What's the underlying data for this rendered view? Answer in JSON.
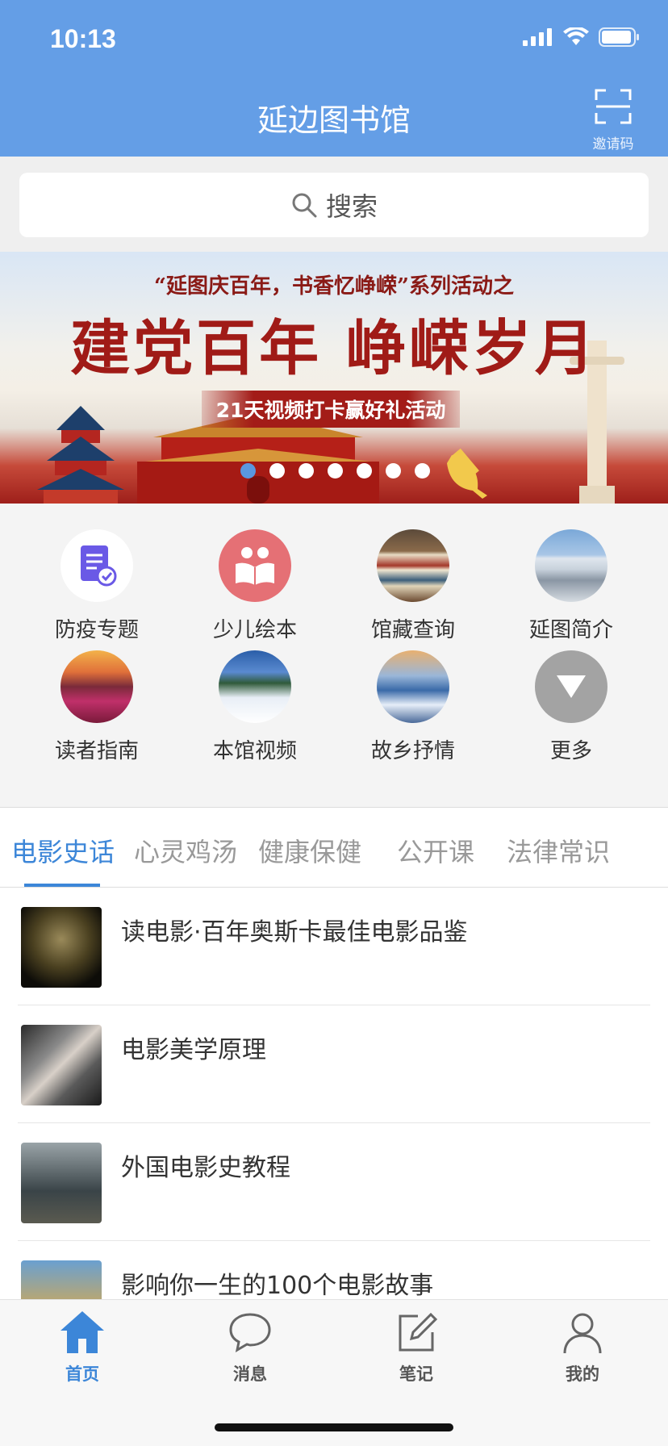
{
  "status_bar": {
    "time": "10:13"
  },
  "header": {
    "title": "延边图书馆",
    "invite_label": "邀请码"
  },
  "search": {
    "placeholder": "搜索"
  },
  "banner": {
    "subtitle": "“延图庆百年，书香忆峥嵘”系列活动之",
    "title": "建党百年  峥嵘岁月",
    "ribbon": "21天视频打卡赢好礼活动",
    "dots_total": 7,
    "dots_active_index": 0,
    "active_dot_color": "#5a97df"
  },
  "grid": [
    {
      "label": "防疫专题",
      "icon": "document-shield-icon"
    },
    {
      "label": "少儿绘本",
      "icon": "children-reading-icon"
    },
    {
      "label": "馆藏查询",
      "icon": "books-photo-icon"
    },
    {
      "label": "延图简介",
      "icon": "library-building-photo-icon"
    },
    {
      "label": "读者指南",
      "icon": "sunset-flowers-photo-icon"
    },
    {
      "label": "本馆视频",
      "icon": "snowy-trees-photo-icon"
    },
    {
      "label": "故乡抒情",
      "icon": "frost-landscape-photo-icon"
    },
    {
      "label": "更多",
      "icon": "triangle-down-icon"
    }
  ],
  "tabs": [
    {
      "label": "电影史话",
      "active": true
    },
    {
      "label": "心灵鸡汤",
      "active": false
    },
    {
      "label": "健康保健",
      "active": false
    },
    {
      "label": "公开课",
      "active": false
    },
    {
      "label": "法律常识",
      "active": false
    }
  ],
  "list": [
    {
      "title": "读电影·百年奥斯卡最佳电影品鉴"
    },
    {
      "title": "电影美学原理"
    },
    {
      "title": "外国电影史教程"
    },
    {
      "title": "影响你一生的100个电影故事"
    }
  ],
  "bottom_nav": [
    {
      "label": "首页",
      "icon": "home-icon",
      "active": true
    },
    {
      "label": "消息",
      "icon": "chat-bubble-icon",
      "active": false
    },
    {
      "label": "笔记",
      "icon": "edit-note-icon",
      "active": false
    },
    {
      "label": "我的",
      "icon": "user-icon",
      "active": false
    }
  ],
  "colors": {
    "header_bg": "#649ee6",
    "accent": "#3c86d8"
  }
}
